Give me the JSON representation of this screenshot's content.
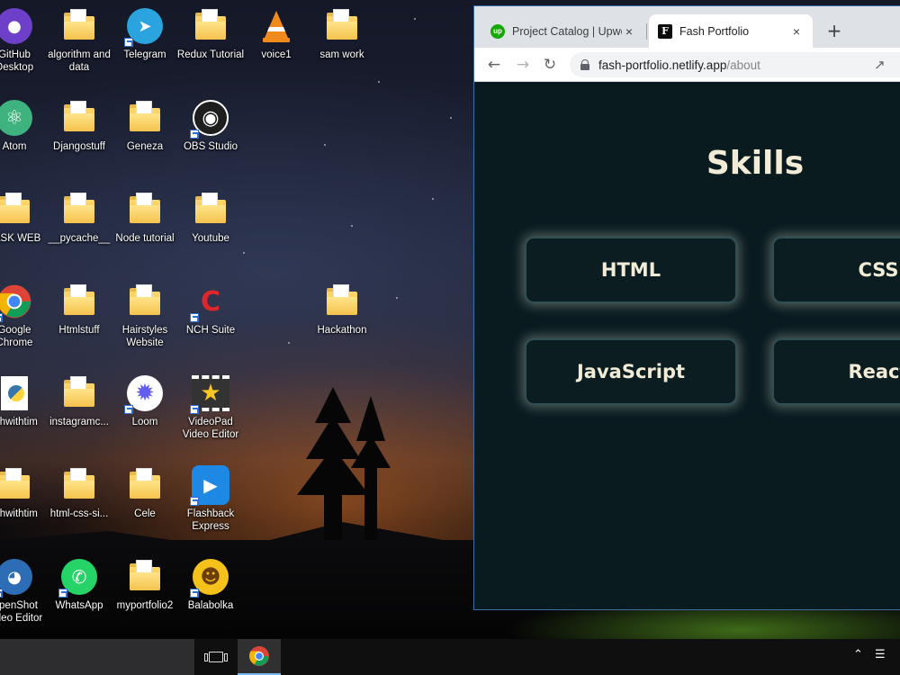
{
  "desktop": {
    "icons": [
      {
        "label": "GitHub Desktop",
        "icon": "github-icon"
      },
      {
        "label": "algorithm and data",
        "icon": "folder-icon"
      },
      {
        "label": "Telegram",
        "icon": "telegram-icon"
      },
      {
        "label": "Redux Tutorial",
        "icon": "folder-icon"
      },
      {
        "label": "voice1",
        "icon": "vlc-icon"
      },
      {
        "label": "sam work",
        "icon": "folder-icon"
      },
      {
        "label": "Atom",
        "icon": "atom-icon"
      },
      {
        "label": "Djangostuff",
        "icon": "folder-icon"
      },
      {
        "label": "Geneza",
        "icon": "folder-icon"
      },
      {
        "label": "OBS Studio",
        "icon": "obs-icon"
      },
      {
        "label": "TASK WEB",
        "icon": "folder-icon"
      },
      {
        "label": "__pycache__",
        "icon": "folder-icon"
      },
      {
        "label": "Node tutorial",
        "icon": "folder-icon"
      },
      {
        "label": "Youtube",
        "icon": "folder-icon"
      },
      {
        "label": "Google Chrome",
        "icon": "chrome-icon"
      },
      {
        "label": "Htmlstuff",
        "icon": "folder-icon"
      },
      {
        "label": "Hairstyles Website",
        "icon": "folder-icon"
      },
      {
        "label": "NCH Suite",
        "icon": "nch-icon"
      },
      {
        "label": "Hackathon",
        "icon": "folder-icon"
      },
      {
        "label": "...hwithtim",
        "icon": "python-file-icon"
      },
      {
        "label": "instagramc...",
        "icon": "folder-icon"
      },
      {
        "label": "Loom",
        "icon": "loom-icon"
      },
      {
        "label": "VideoPad Video Editor",
        "icon": "videopad-icon"
      },
      {
        "label": "...hwithtim",
        "icon": "folder-icon"
      },
      {
        "label": "html-css-si...",
        "icon": "folder-icon"
      },
      {
        "label": "Cele",
        "icon": "folder-icon"
      },
      {
        "label": "Flashback Express",
        "icon": "flashback-icon"
      },
      {
        "label": "OpenShot Video Editor",
        "icon": "openshot-icon"
      },
      {
        "label": "WhatsApp",
        "icon": "whatsapp-icon"
      },
      {
        "label": "myportfolio2",
        "icon": "folder-icon"
      },
      {
        "label": "Balabolka",
        "icon": "balabolka-icon"
      }
    ]
  },
  "browser": {
    "tabs": [
      {
        "title": "Project Catalog | Upwork",
        "favicon": "upwork-icon",
        "close": "×"
      },
      {
        "title": "Fash Portfolio",
        "favicon": "fash-icon",
        "close": "×"
      }
    ],
    "new_tab": "+",
    "url_host": "fash-portfolio.netlify.app",
    "url_path": "/about"
  },
  "page": {
    "title": "Skills",
    "skills": [
      "HTML",
      "CSS",
      "JavaScript",
      "React"
    ]
  },
  "colors": {
    "page_bg": "#0a1b20",
    "text_cream": "#f2ecd6",
    "card_glow": "#d7e1c8"
  }
}
